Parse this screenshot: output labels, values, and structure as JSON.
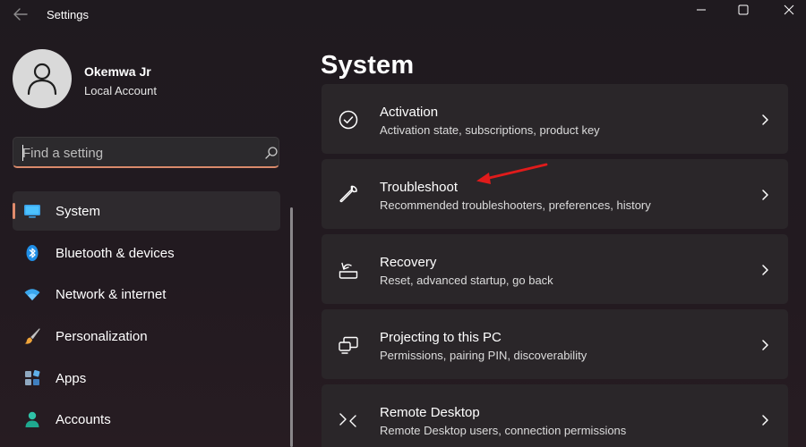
{
  "window": {
    "title": "Settings"
  },
  "profile": {
    "name": "Okemwa Jr",
    "account_type": "Local Account"
  },
  "search": {
    "placeholder": "Find a setting"
  },
  "nav": {
    "items": [
      {
        "label": "System",
        "icon": "monitor-icon",
        "active": true
      },
      {
        "label": "Bluetooth & devices",
        "icon": "bluetooth-icon"
      },
      {
        "label": "Network & internet",
        "icon": "wifi-icon"
      },
      {
        "label": "Personalization",
        "icon": "brush-icon"
      },
      {
        "label": "Apps",
        "icon": "apps-icon"
      },
      {
        "label": "Accounts",
        "icon": "person-icon"
      }
    ]
  },
  "main": {
    "title": "System",
    "cards": [
      {
        "title": "Activation",
        "subtitle": "Activation state, subscriptions, product key",
        "icon": "check-circle-icon"
      },
      {
        "title": "Troubleshoot",
        "subtitle": "Recommended troubleshooters, preferences, history",
        "icon": "wrench-icon"
      },
      {
        "title": "Recovery",
        "subtitle": "Reset, advanced startup, go back",
        "icon": "recovery-icon"
      },
      {
        "title": "Projecting to this PC",
        "subtitle": "Permissions, pairing PIN, discoverability",
        "icon": "projecting-icon"
      },
      {
        "title": "Remote Desktop",
        "subtitle": "Remote Desktop users, connection permissions",
        "icon": "remote-desktop-icon"
      }
    ]
  },
  "colors": {
    "accent": "#e08b6c",
    "annotation_arrow": "#e01b1b"
  }
}
